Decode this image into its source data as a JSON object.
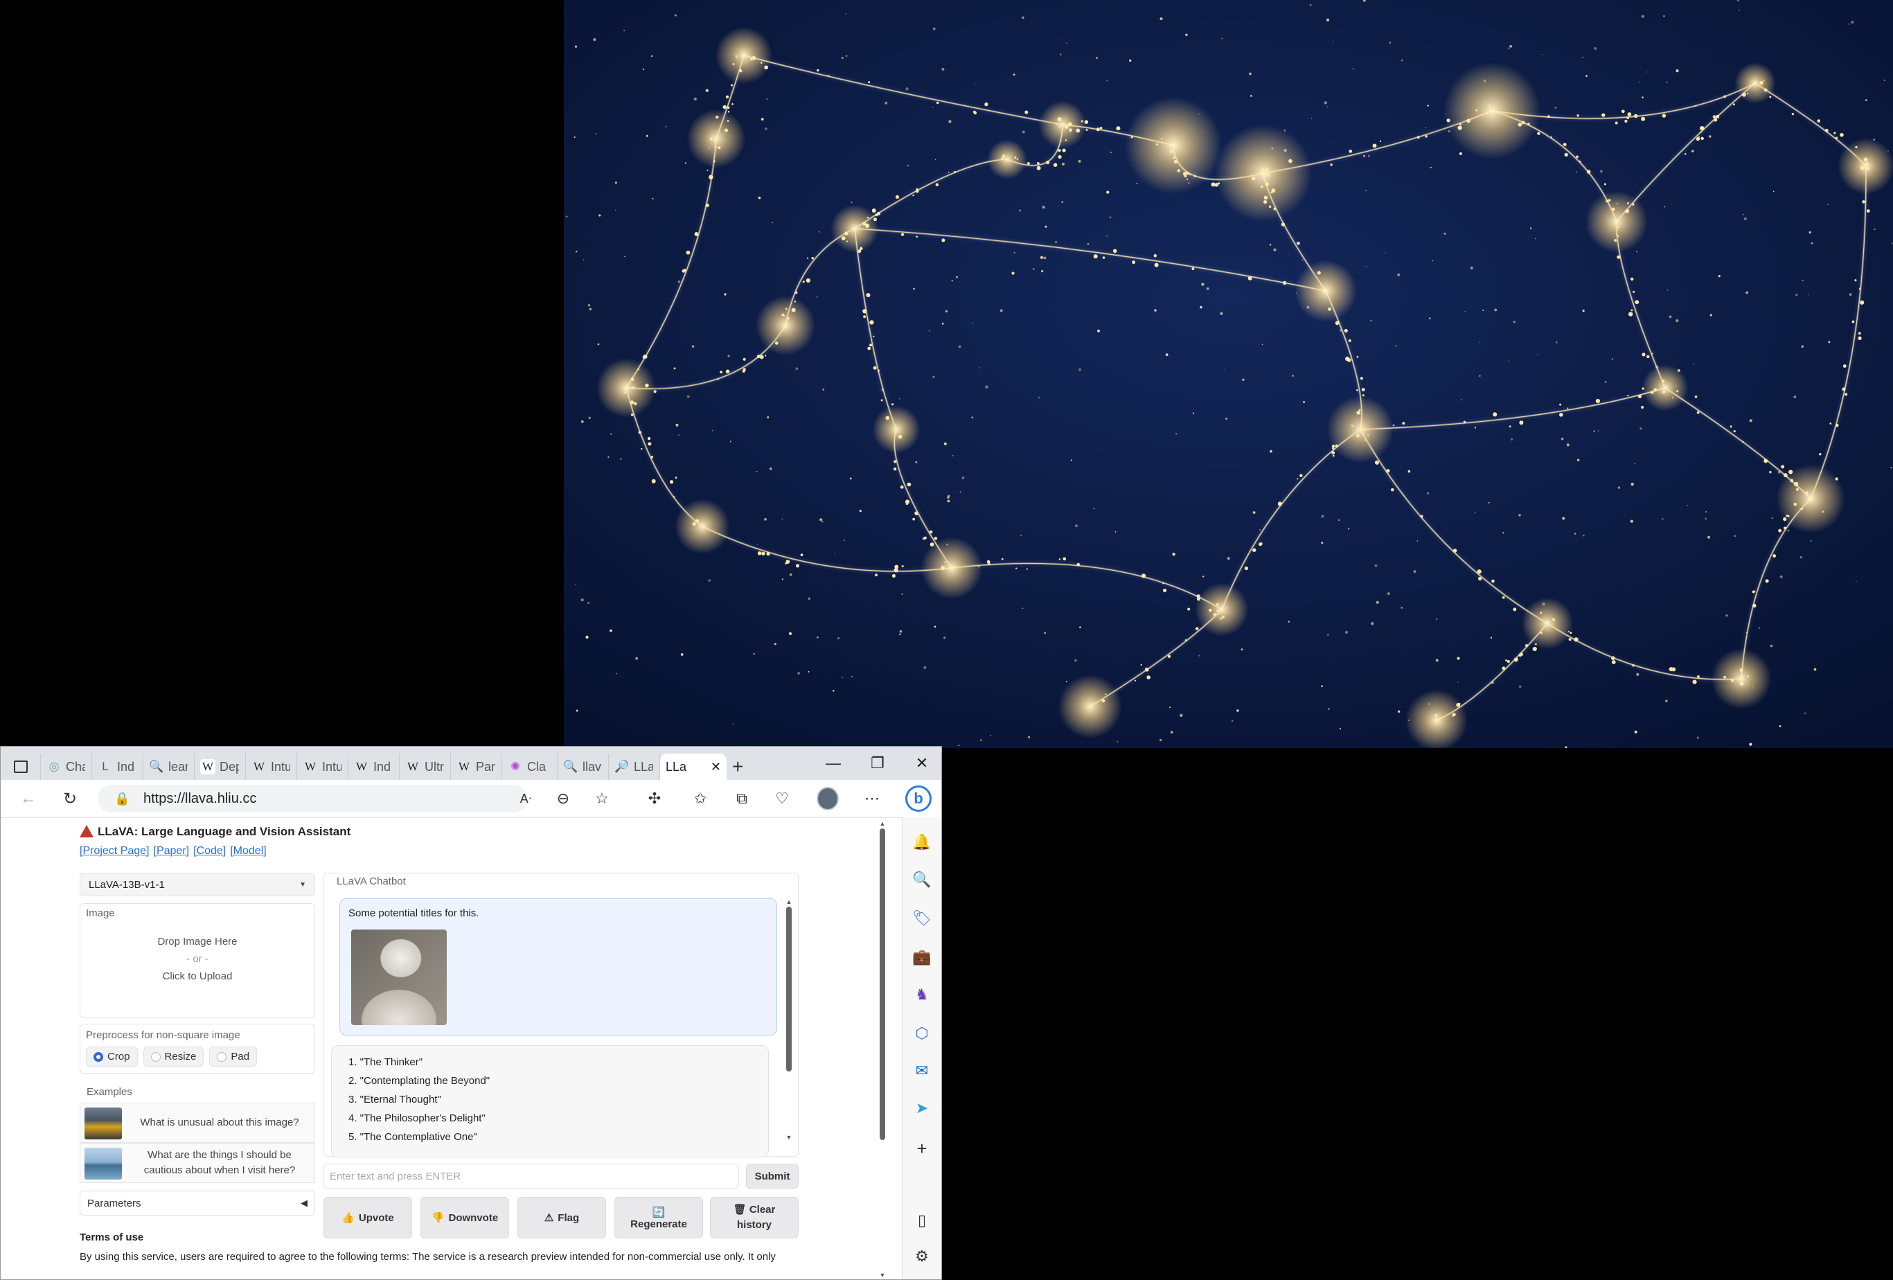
{
  "browser": {
    "tabs": [
      {
        "label": "Cha",
        "icon": "chatgpt-icon"
      },
      {
        "label": "Ind",
        "icon": "letter-l-icon"
      },
      {
        "label": "lear",
        "icon": "search-icon"
      },
      {
        "label": "Dep",
        "icon": "wikipedia-icon"
      },
      {
        "label": "Intu",
        "icon": "wikipedia-icon"
      },
      {
        "label": "Intu",
        "icon": "wikipedia-icon"
      },
      {
        "label": "Ind",
        "icon": "wikipedia-icon"
      },
      {
        "label": "Ultr",
        "icon": "wikipedia-icon"
      },
      {
        "label": "Pan",
        "icon": "wikipedia-icon"
      },
      {
        "label": "Cla",
        "icon": "claude-icon"
      },
      {
        "label": "llav",
        "icon": "search-icon"
      },
      {
        "label": "LLa",
        "icon": "magnifier-icon"
      }
    ],
    "active_tab": {
      "label": "LLa"
    },
    "url": "https://llava.hliu.cc"
  },
  "app": {
    "title": "LLaVA: Large Language and Vision Assistant",
    "links": [
      "[Project Page]",
      "[Paper]",
      "[Code]",
      "[Model]"
    ],
    "model_select": {
      "value": "LLaVA-13B-v1-1"
    },
    "image_panel": {
      "label": "Image",
      "drop_text": "Drop Image Here",
      "or_text": "- or -",
      "click_text": "Click to Upload"
    },
    "preprocess": {
      "label": "Preprocess for non-square image",
      "options": [
        "Crop",
        "Resize",
        "Pad"
      ],
      "selected": "Crop"
    },
    "examples": {
      "label": "Examples",
      "items": [
        "What is unusual about this image?",
        "What are the things I should be cautious about when I visit here?"
      ]
    },
    "parameters": {
      "label": "Parameters"
    },
    "chatbot": {
      "label": "LLaVA Chatbot",
      "user_message": "Some potential titles for this.",
      "bot_list": [
        "1. \"The Thinker\"",
        "2. \"Contemplating the Beyond\"",
        "3. \"Eternal Thought\"",
        "4. \"The Philosopher's Delight\"",
        "5. \"The Contemplative One\""
      ]
    },
    "input": {
      "placeholder": "Enter text and press ENTER"
    },
    "buttons": {
      "submit": "Submit",
      "upvote": "Upvote",
      "downvote": "Downvote",
      "flag": "Flag",
      "regenerate": "Regenerate",
      "clear_line1": "Clear",
      "clear_line2": "history"
    },
    "terms": {
      "title": "Terms of use",
      "text": "By using this service, users are required to agree to the following terms: The service is a research preview intended for non-commercial use only. It only"
    }
  },
  "colors": {
    "accent": "#3566d6",
    "link": "#2b6cd4",
    "user_bubble": "#eef4ff",
    "wallpaper_bg": "#0b1a3e",
    "wallpaper_glow": "#ffd98a"
  }
}
